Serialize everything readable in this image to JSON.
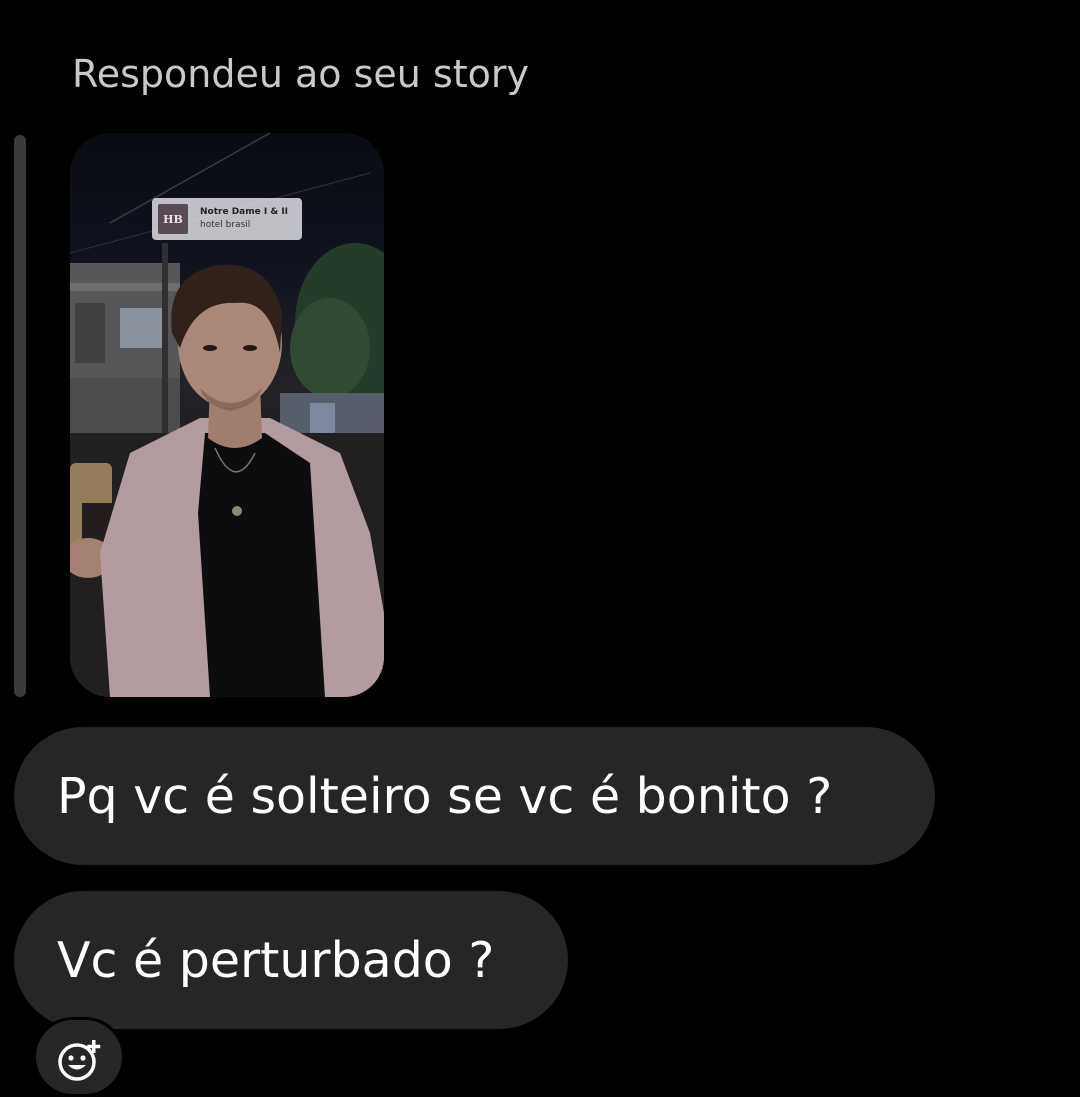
{
  "reply_header": "Respondeu ao seu story",
  "story": {
    "music_sticker": {
      "cover_text": "HB",
      "title": "Notre Dame I & II",
      "artist": "hotel brasil"
    }
  },
  "messages": [
    {
      "text": "Pq vc é solteiro se vc é bonito ?"
    },
    {
      "text": "Vc é perturbado ?"
    }
  ],
  "reaction_button": {
    "icon": "add-reaction-icon"
  },
  "colors": {
    "background": "#000000",
    "bubble": "#262626",
    "header_text": "#c9c9c9",
    "message_text": "#ffffff"
  }
}
